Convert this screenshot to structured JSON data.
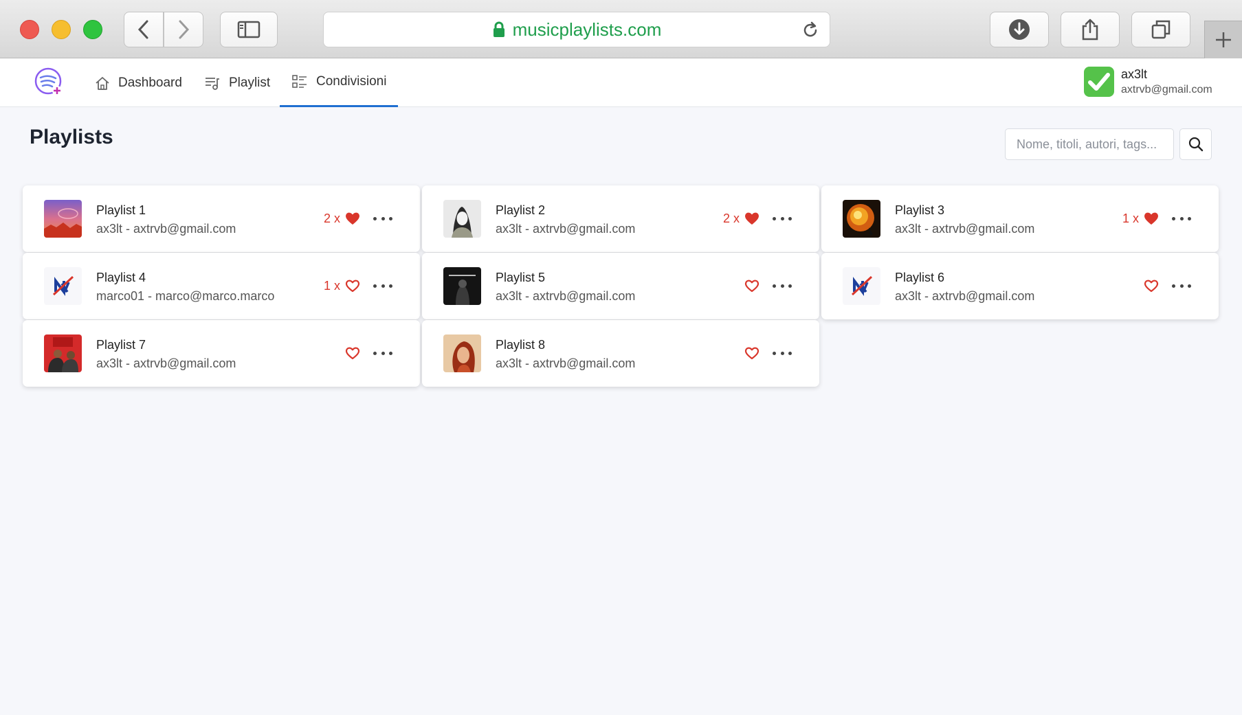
{
  "browser": {
    "url": "musicplaylists.com"
  },
  "nav": {
    "items": [
      {
        "label": "Dashboard",
        "icon": "home-icon"
      },
      {
        "label": "Playlist",
        "icon": "playlist-icon"
      },
      {
        "label": "Condivisioni",
        "icon": "share-list-icon",
        "active": true
      }
    ]
  },
  "user": {
    "name": "ax3lt",
    "email": "axtrvb@gmail.com"
  },
  "page": {
    "title": "Playlists",
    "search_placeholder": "Nome, titoli, autori, tags..."
  },
  "colors": {
    "accent": "#1f6fd1",
    "like": "#d9362b",
    "url": "#1f9e4c"
  },
  "playlists": [
    {
      "name": "Playlist 1",
      "owner": "ax3lt - axtrvb@gmail.com",
      "likes": "2 x",
      "liked": true,
      "cover": "sunset-cover"
    },
    {
      "name": "Playlist 2",
      "owner": "ax3lt - axtrvb@gmail.com",
      "likes": "2 x",
      "liked": true,
      "cover": "artist-portrait-cover"
    },
    {
      "name": "Playlist 3",
      "owner": "ax3lt - axtrvb@gmail.com",
      "likes": "1 x",
      "liked": true,
      "cover": "fire-explosion-cover"
    },
    {
      "name": "Playlist 4",
      "owner": "marco01 - marco@marco.marco",
      "likes": "1 x",
      "liked": false,
      "cover": "ny-logo-cover"
    },
    {
      "name": "Playlist 5",
      "owner": "ax3lt - axtrvb@gmail.com",
      "likes": "",
      "liked": false,
      "cover": "dark-album-cover"
    },
    {
      "name": "Playlist 6",
      "owner": "ax3lt - axtrvb@gmail.com",
      "likes": "",
      "liked": false,
      "cover": "ny-logo-cover"
    },
    {
      "name": "Playlist 7",
      "owner": "ax3lt - axtrvb@gmail.com",
      "likes": "",
      "liked": false,
      "cover": "red-321-cover"
    },
    {
      "name": "Playlist 8",
      "owner": "ax3lt - axtrvb@gmail.com",
      "likes": "",
      "liked": false,
      "cover": "woman-portrait-cover"
    }
  ]
}
